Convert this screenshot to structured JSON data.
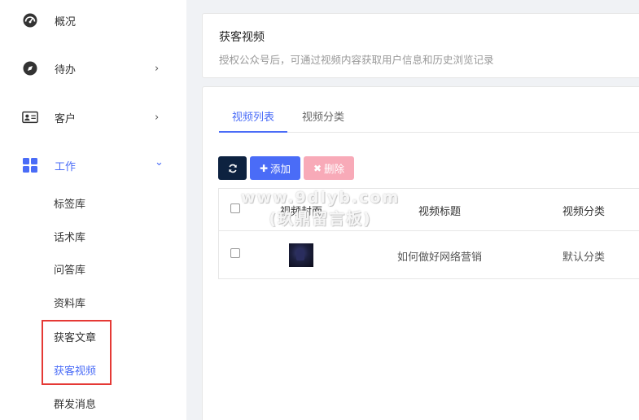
{
  "sidebar": {
    "items": [
      {
        "label": "概况",
        "icon": "dashboard-icon"
      },
      {
        "label": "待办",
        "icon": "compass-icon",
        "arrow": "›"
      },
      {
        "label": "客户",
        "icon": "id-card-icon",
        "arrow": "›"
      },
      {
        "label": "工作",
        "icon": "grid-icon",
        "arrow": "⌄"
      }
    ],
    "subitems": [
      "标签库",
      "话术库",
      "问答库",
      "资料库",
      "获客文章",
      "获客视频",
      "群发消息"
    ]
  },
  "header": {
    "title": "获客视频",
    "description": "授权公众号后，可通过视频内容获取用户信息和历史浏览记录"
  },
  "tabs": [
    "视频列表",
    "视频分类"
  ],
  "toolbar": {
    "add_label": "添加",
    "delete_label": "删除"
  },
  "table": {
    "columns": [
      "视频封面",
      "视频标题",
      "视频分类"
    ],
    "rows": [
      {
        "title": "如何做好网络营销",
        "category": "默认分类"
      }
    ]
  },
  "watermark": {
    "line1": "www.9dlyb.com",
    "line2": "(玖鼎留言板)"
  },
  "colors": {
    "accent": "#4a6cf7",
    "highlight": "#e53935",
    "refresh_button": "#0d2240",
    "delete_button": "#f8aab8"
  }
}
